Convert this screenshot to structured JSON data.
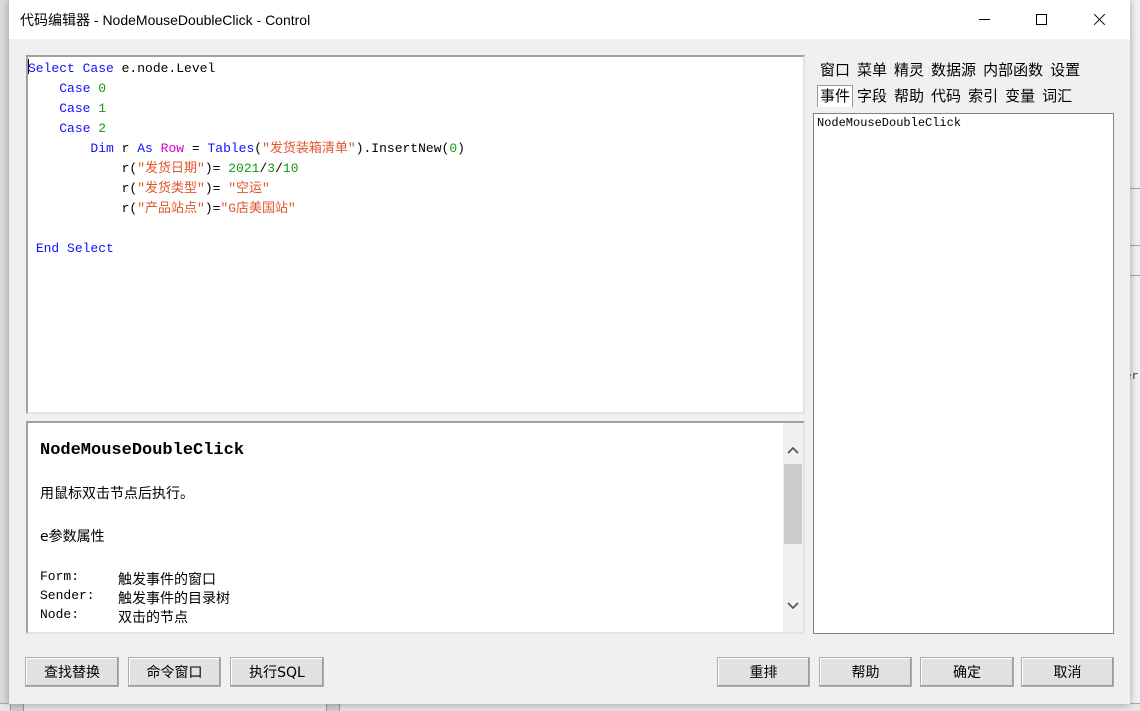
{
  "window": {
    "title": "代码编辑器 - NodeMouseDoubleClick - Control"
  },
  "code": {
    "l1": {
      "a": "Select Case",
      "b": " e.node.Level"
    },
    "l2": {
      "a": "Case",
      "b": "0"
    },
    "l3": {
      "a": "Case",
      "b": "1"
    },
    "l4": {
      "a": "Case",
      "b": "2"
    },
    "l5": {
      "dim": "Dim",
      "r": " r ",
      "as": "As",
      "row": "Row",
      "eq": " = ",
      "tables": "Tables",
      "open": "(",
      "str": "\"发货装箱清单\"",
      "close": ").InsertNew(",
      "num": "0",
      "end": ")"
    },
    "l6": {
      "a": "r(",
      "str": "\"发货日期\"",
      "b": ")= ",
      "n1": "2021",
      "s1": "/",
      "n2": "3",
      "s2": "/",
      "n3": "10"
    },
    "l7": {
      "a": "r(",
      "str": "\"发货类型\"",
      "b": ")= ",
      "val": "\"空运\""
    },
    "l8": {
      "a": "r(",
      "str": "\"产品站点\"",
      "b": ")=",
      "val": "\"G店美国站\""
    },
    "l10": {
      "a": "End Select"
    }
  },
  "help": {
    "title": "NodeMouseDoubleClick",
    "description": "用鼠标双击节点后执行。",
    "subtitle": "e参数属性",
    "props": [
      {
        "key": "Form:",
        "value": "触发事件的窗口"
      },
      {
        "key": "Sender:",
        "value": "触发事件的目录树"
      },
      {
        "key": "Node:",
        "value": "双击的节点"
      }
    ]
  },
  "tabs": {
    "row1": [
      "窗口",
      "菜单",
      "精灵",
      "数据源",
      "内部函数",
      "设置"
    ],
    "row2": [
      "事件",
      "字段",
      "帮助",
      "代码",
      "索引",
      "变量",
      "词汇"
    ]
  },
  "event_list": [
    "NodeMouseDoubleClick"
  ],
  "buttons": {
    "find_replace": "查找替换",
    "command_window": "命令窗口",
    "exec_sql": "执行SQL",
    "rearrange": "重排",
    "help": "帮助",
    "ok": "确定",
    "cancel": "取消"
  },
  "background": {
    "edge_text": "er"
  }
}
